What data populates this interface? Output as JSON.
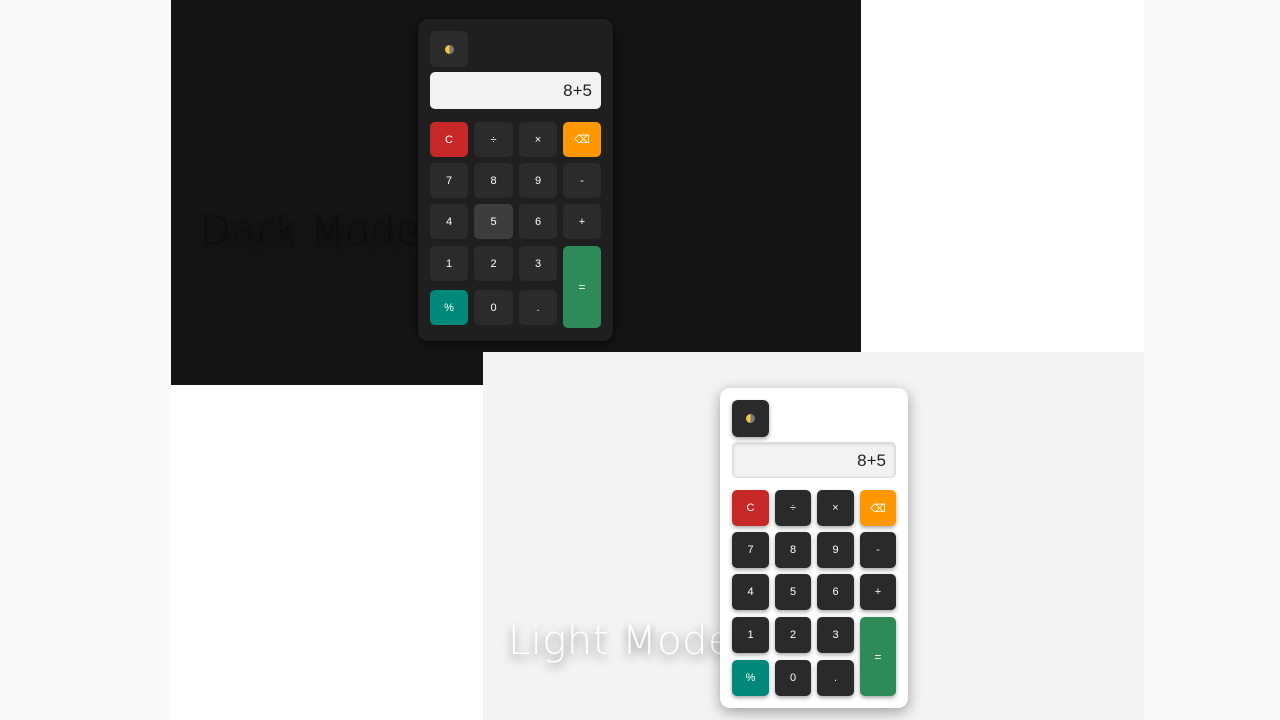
{
  "captions": {
    "dark": "Dark Mode",
    "light": "Light Mode"
  },
  "calculators": {
    "dark": {
      "toggle_icon": "theme-toggle-icon",
      "display": "8+5",
      "keys": [
        "C",
        "÷",
        "×",
        "⌫",
        "7",
        "8",
        "9",
        "-",
        "4",
        "5",
        "6",
        "+",
        "1",
        "2",
        "3",
        "=",
        "%",
        "0",
        "."
      ]
    },
    "light": {
      "toggle_icon": "theme-toggle-icon",
      "display": "8+5",
      "keys": [
        "C",
        "÷",
        "×",
        "⌫",
        "7",
        "8",
        "9",
        "-",
        "4",
        "5",
        "6",
        "+",
        "1",
        "2",
        "3",
        "=",
        "%",
        "0",
        "."
      ]
    }
  },
  "colors": {
    "clear": "#c62828",
    "backspace": "#ff9800",
    "percent": "#00897b",
    "equals": "#2e8b57",
    "dark_bg": "#141414",
    "light_bg": "#f3f3f3"
  }
}
